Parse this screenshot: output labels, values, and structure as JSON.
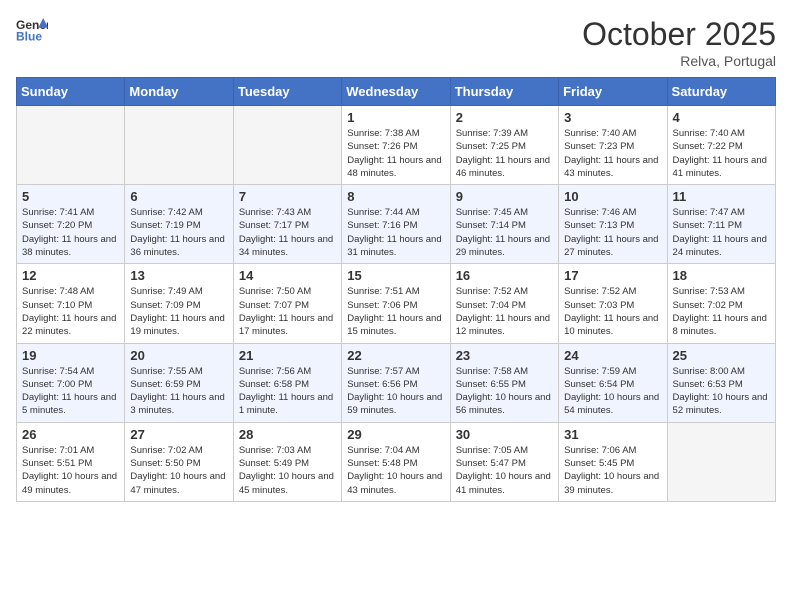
{
  "header": {
    "logo_line1": "General",
    "logo_line2": "Blue",
    "month": "October 2025",
    "location": "Relva, Portugal"
  },
  "weekdays": [
    "Sunday",
    "Monday",
    "Tuesday",
    "Wednesday",
    "Thursday",
    "Friday",
    "Saturday"
  ],
  "weeks": [
    [
      {
        "day": "",
        "empty": true
      },
      {
        "day": "",
        "empty": true
      },
      {
        "day": "",
        "empty": true
      },
      {
        "day": "1",
        "sunrise": "7:38 AM",
        "sunset": "7:26 PM",
        "daylight": "11 hours and 48 minutes."
      },
      {
        "day": "2",
        "sunrise": "7:39 AM",
        "sunset": "7:25 PM",
        "daylight": "11 hours and 46 minutes."
      },
      {
        "day": "3",
        "sunrise": "7:40 AM",
        "sunset": "7:23 PM",
        "daylight": "11 hours and 43 minutes."
      },
      {
        "day": "4",
        "sunrise": "7:40 AM",
        "sunset": "7:22 PM",
        "daylight": "11 hours and 41 minutes."
      }
    ],
    [
      {
        "day": "5",
        "sunrise": "7:41 AM",
        "sunset": "7:20 PM",
        "daylight": "11 hours and 38 minutes."
      },
      {
        "day": "6",
        "sunrise": "7:42 AM",
        "sunset": "7:19 PM",
        "daylight": "11 hours and 36 minutes."
      },
      {
        "day": "7",
        "sunrise": "7:43 AM",
        "sunset": "7:17 PM",
        "daylight": "11 hours and 34 minutes."
      },
      {
        "day": "8",
        "sunrise": "7:44 AM",
        "sunset": "7:16 PM",
        "daylight": "11 hours and 31 minutes."
      },
      {
        "day": "9",
        "sunrise": "7:45 AM",
        "sunset": "7:14 PM",
        "daylight": "11 hours and 29 minutes."
      },
      {
        "day": "10",
        "sunrise": "7:46 AM",
        "sunset": "7:13 PM",
        "daylight": "11 hours and 27 minutes."
      },
      {
        "day": "11",
        "sunrise": "7:47 AM",
        "sunset": "7:11 PM",
        "daylight": "11 hours and 24 minutes."
      }
    ],
    [
      {
        "day": "12",
        "sunrise": "7:48 AM",
        "sunset": "7:10 PM",
        "daylight": "11 hours and 22 minutes."
      },
      {
        "day": "13",
        "sunrise": "7:49 AM",
        "sunset": "7:09 PM",
        "daylight": "11 hours and 19 minutes."
      },
      {
        "day": "14",
        "sunrise": "7:50 AM",
        "sunset": "7:07 PM",
        "daylight": "11 hours and 17 minutes."
      },
      {
        "day": "15",
        "sunrise": "7:51 AM",
        "sunset": "7:06 PM",
        "daylight": "11 hours and 15 minutes."
      },
      {
        "day": "16",
        "sunrise": "7:52 AM",
        "sunset": "7:04 PM",
        "daylight": "11 hours and 12 minutes."
      },
      {
        "day": "17",
        "sunrise": "7:52 AM",
        "sunset": "7:03 PM",
        "daylight": "11 hours and 10 minutes."
      },
      {
        "day": "18",
        "sunrise": "7:53 AM",
        "sunset": "7:02 PM",
        "daylight": "11 hours and 8 minutes."
      }
    ],
    [
      {
        "day": "19",
        "sunrise": "7:54 AM",
        "sunset": "7:00 PM",
        "daylight": "11 hours and 5 minutes."
      },
      {
        "day": "20",
        "sunrise": "7:55 AM",
        "sunset": "6:59 PM",
        "daylight": "11 hours and 3 minutes."
      },
      {
        "day": "21",
        "sunrise": "7:56 AM",
        "sunset": "6:58 PM",
        "daylight": "11 hours and 1 minute."
      },
      {
        "day": "22",
        "sunrise": "7:57 AM",
        "sunset": "6:56 PM",
        "daylight": "10 hours and 59 minutes."
      },
      {
        "day": "23",
        "sunrise": "7:58 AM",
        "sunset": "6:55 PM",
        "daylight": "10 hours and 56 minutes."
      },
      {
        "day": "24",
        "sunrise": "7:59 AM",
        "sunset": "6:54 PM",
        "daylight": "10 hours and 54 minutes."
      },
      {
        "day": "25",
        "sunrise": "8:00 AM",
        "sunset": "6:53 PM",
        "daylight": "10 hours and 52 minutes."
      }
    ],
    [
      {
        "day": "26",
        "sunrise": "7:01 AM",
        "sunset": "5:51 PM",
        "daylight": "10 hours and 49 minutes."
      },
      {
        "day": "27",
        "sunrise": "7:02 AM",
        "sunset": "5:50 PM",
        "daylight": "10 hours and 47 minutes."
      },
      {
        "day": "28",
        "sunrise": "7:03 AM",
        "sunset": "5:49 PM",
        "daylight": "10 hours and 45 minutes."
      },
      {
        "day": "29",
        "sunrise": "7:04 AM",
        "sunset": "5:48 PM",
        "daylight": "10 hours and 43 minutes."
      },
      {
        "day": "30",
        "sunrise": "7:05 AM",
        "sunset": "5:47 PM",
        "daylight": "10 hours and 41 minutes."
      },
      {
        "day": "31",
        "sunrise": "7:06 AM",
        "sunset": "5:45 PM",
        "daylight": "10 hours and 39 minutes."
      },
      {
        "day": "",
        "empty": true
      }
    ]
  ],
  "labels": {
    "sunrise": "Sunrise:",
    "sunset": "Sunset:",
    "daylight": "Daylight:"
  }
}
